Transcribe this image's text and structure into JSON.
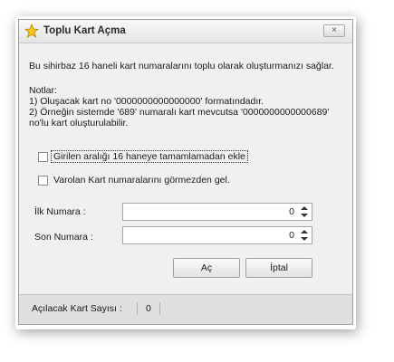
{
  "window": {
    "title": "Toplu Kart Açma",
    "close_label": "×"
  },
  "intro": "Bu sihirbaz 16 haneli kart numaralarını toplu olarak oluşturmanızı sağlar.",
  "notes": {
    "heading": "Notlar:",
    "line1": "1) Oluşacak kart no '0000000000000000' formatındadır.",
    "line2": "2) Örneğin sistemde '689' numaralı kart mevcutsa '0000000000000689'",
    "line3": "no'lu kart oluşturulabilir."
  },
  "options": {
    "pad_label": "Girilen aralığı 16 haneye tamamlamadan ekle",
    "pad_checked": false,
    "ignore_label": "Varolan Kart numaralarını görmezden gel.",
    "ignore_checked": false
  },
  "fields": {
    "first_label": "İlk Numara :",
    "first_value": "0",
    "last_label": "Son Numara :",
    "last_value": "0"
  },
  "buttons": {
    "open_label": "Aç",
    "cancel_label": "İptal"
  },
  "status": {
    "label": "Açılacak Kart Sayısı :",
    "value": "0"
  },
  "icons": {
    "title": "star-icon",
    "close": "close-icon",
    "spin_up": "arrow-up-icon",
    "spin_down": "arrow-down-icon"
  }
}
